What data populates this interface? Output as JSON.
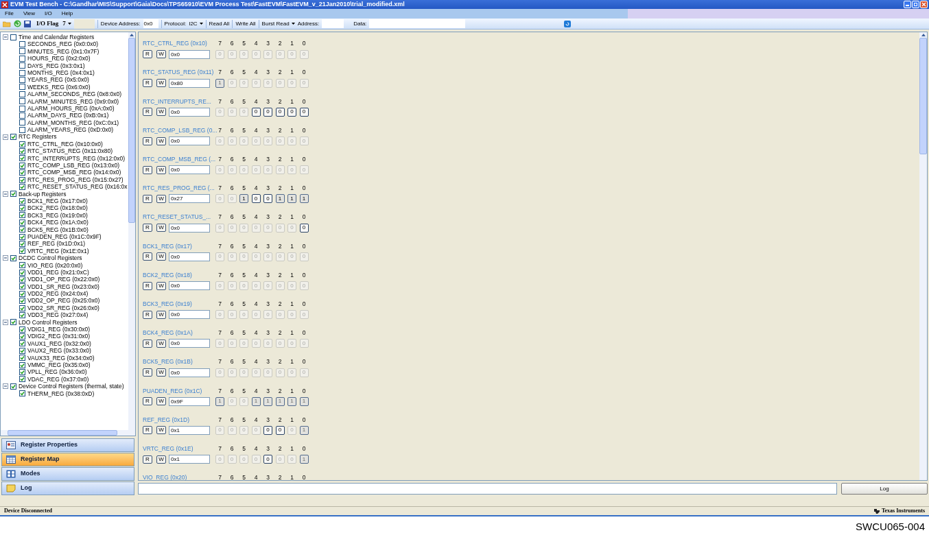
{
  "window": {
    "title": "EVM Test Bench - C:\\Gandhar\\MIS\\Support\\Gaia\\Docs\\TPS65910\\EVM Process Test\\FastEVM\\FastEVM_v_21Jan2010\\trial_modified.xml"
  },
  "menu": [
    "File",
    "View",
    "I/O",
    "Help"
  ],
  "toolbar": {
    "io_flag": {
      "label": "I/O Flag",
      "value": "7"
    },
    "device_address": {
      "label": "Device Address:",
      "value": "0x0"
    },
    "protocol": {
      "label": "Protocol:",
      "value": "I2C"
    },
    "read_all": "Read All",
    "write_all": "Write All",
    "burst_read": "Burst Read",
    "address": {
      "label": "Address:"
    },
    "data": {
      "label": "Data:"
    }
  },
  "tree": [
    {
      "label": "Time and Calendar Registers",
      "checked": false,
      "expanded": true,
      "children": [
        {
          "label": "SECONDS_REG (0x0:0x0)",
          "checked": false
        },
        {
          "label": "MINUTES_REG (0x1:0x7F)",
          "checked": false
        },
        {
          "label": "HOURS_REG (0x2:0x0)",
          "checked": false
        },
        {
          "label": "DAYS_REG (0x3:0x1)",
          "checked": false
        },
        {
          "label": "MONTHS_REG (0x4:0x1)",
          "checked": false
        },
        {
          "label": "YEARS_REG (0x5:0x0)",
          "checked": false
        },
        {
          "label": "WEEKS_REG (0x6:0x0)",
          "checked": false
        },
        {
          "label": "ALARM_SECONDS_REG (0x8:0x0)",
          "checked": false
        },
        {
          "label": "ALARM_MINUTES_REG (0x9:0x0)",
          "checked": false
        },
        {
          "label": "ALARM_HOURS_REG (0xA:0x0)",
          "checked": false
        },
        {
          "label": "ALARM_DAYS_REG (0xB:0x1)",
          "checked": false
        },
        {
          "label": "ALARM_MONTHS_REG (0xC:0x1)",
          "checked": false
        },
        {
          "label": "ALARM_YEARS_REG (0xD:0x0)",
          "checked": false
        }
      ]
    },
    {
      "label": "RTC Registers",
      "checked": true,
      "expanded": true,
      "children": [
        {
          "label": "RTC_CTRL_REG (0x10:0x0)",
          "checked": true
        },
        {
          "label": "RTC_STATUS_REG (0x11:0x80)",
          "checked": true
        },
        {
          "label": "RTC_INTERRUPTS_REG (0x12:0x0)",
          "checked": true
        },
        {
          "label": "RTC_COMP_LSB_REG (0x13:0x0)",
          "checked": true
        },
        {
          "label": "RTC_COMP_MSB_REG (0x14:0x0)",
          "checked": true
        },
        {
          "label": "RTC_RES_PROG_REG (0x15:0x27)",
          "checked": true
        },
        {
          "label": "RTC_RESET_STATUS_REG (0x16:0x",
          "checked": true
        }
      ]
    },
    {
      "label": "Back-up Registers",
      "checked": true,
      "expanded": true,
      "children": [
        {
          "label": "BCK1_REG (0x17:0x0)",
          "checked": true
        },
        {
          "label": "BCK2_REG (0x18:0x0)",
          "checked": true
        },
        {
          "label": "BCK3_REG (0x19:0x0)",
          "checked": true
        },
        {
          "label": "BCK4_REG (0x1A:0x0)",
          "checked": true
        },
        {
          "label": "BCK5_REG (0x1B:0x0)",
          "checked": true
        },
        {
          "label": "PUADEN_REG (0x1C:0x9F)",
          "checked": true
        },
        {
          "label": "REF_REG (0x1D:0x1)",
          "checked": true
        },
        {
          "label": "VRTC_REG (0x1E:0x1)",
          "checked": true
        }
      ]
    },
    {
      "label": "DCDC Control Registers",
      "checked": true,
      "expanded": true,
      "children": [
        {
          "label": "VIO_REG (0x20:0x0)",
          "checked": true
        },
        {
          "label": "VDD1_REG (0x21:0xC)",
          "checked": true
        },
        {
          "label": "VDD1_OP_REG (0x22:0x0)",
          "checked": true
        },
        {
          "label": "VDD1_SR_REG (0x23:0x0)",
          "checked": true
        },
        {
          "label": "VDD2_REG (0x24:0x4)",
          "checked": true
        },
        {
          "label": "VDD2_OP_REG (0x25:0x0)",
          "checked": true
        },
        {
          "label": "VDD2_SR_REG (0x26:0x0)",
          "checked": true
        },
        {
          "label": "VDD3_REG (0x27:0x4)",
          "checked": true
        }
      ]
    },
    {
      "label": "LDO Control Registers",
      "checked": true,
      "expanded": true,
      "children": [
        {
          "label": "VDIG1_REG (0x30:0x0)",
          "checked": true
        },
        {
          "label": "VDIG2_REG (0x31:0x0)",
          "checked": true
        },
        {
          "label": "VAUX1_REG (0x32:0x0)",
          "checked": true
        },
        {
          "label": "VAUX2_REG (0x33:0x0)",
          "checked": true
        },
        {
          "label": "VAUX33_REG (0x34:0x0)",
          "checked": true
        },
        {
          "label": "VMMC_REG (0x35:0x0)",
          "checked": true
        },
        {
          "label": "VPLL_REG (0x36:0x0)",
          "checked": true
        },
        {
          "label": "VDAC_REG (0x37:0x0)",
          "checked": true
        }
      ]
    },
    {
      "label": "Device Control Registers (thermal, state)",
      "checked": true,
      "expanded": true,
      "children": [
        {
          "label": "THERM_REG (0x38:0xD)",
          "checked": true
        }
      ]
    }
  ],
  "nav": [
    {
      "label": "Register Properties",
      "selected": false,
      "kind": "properties"
    },
    {
      "label": "Register Map",
      "selected": true,
      "kind": "map"
    },
    {
      "label": "Modes",
      "selected": false,
      "kind": "modes"
    },
    {
      "label": "Log",
      "selected": false,
      "kind": "log"
    }
  ],
  "registers": [
    {
      "name": "RTC_CTRL_REG (0x10)",
      "read": "R",
      "write": "W",
      "value": "0x0",
      "bits": [
        {
          "index": "7",
          "value": "0",
          "enabled": false,
          "pressed": false
        },
        {
          "index": "6",
          "value": "0",
          "enabled": false,
          "pressed": false
        },
        {
          "index": "5",
          "value": "0",
          "enabled": false,
          "pressed": false
        },
        {
          "index": "4",
          "value": "0",
          "enabled": false,
          "pressed": false
        },
        {
          "index": "3",
          "value": "0",
          "enabled": false,
          "pressed": false
        },
        {
          "index": "2",
          "value": "0",
          "enabled": false,
          "pressed": false
        },
        {
          "index": "1",
          "value": "0",
          "enabled": false,
          "pressed": false
        },
        {
          "index": "0",
          "value": "0",
          "enabled": false,
          "pressed": false
        }
      ]
    },
    {
      "name": "RTC_STATUS_REG (0x11)",
      "read": "R",
      "write": "W",
      "value": "0x80",
      "bits": [
        {
          "index": "7",
          "value": "1",
          "enabled": false,
          "pressed": true
        },
        {
          "index": "6",
          "value": "0",
          "enabled": false,
          "pressed": false
        },
        {
          "index": "5",
          "value": "0",
          "enabled": false,
          "pressed": false
        },
        {
          "index": "4",
          "value": "0",
          "enabled": false,
          "pressed": false
        },
        {
          "index": "3",
          "value": "0",
          "enabled": false,
          "pressed": false
        },
        {
          "index": "2",
          "value": "0",
          "enabled": false,
          "pressed": false
        },
        {
          "index": "1",
          "value": "0",
          "enabled": false,
          "pressed": false
        },
        {
          "index": "0",
          "value": "0",
          "enabled": false,
          "pressed": false
        }
      ]
    },
    {
      "name": "RTC_INTERRUPTS_RE...",
      "read": "R",
      "write": "W",
      "value": "0x0",
      "bits": [
        {
          "index": "7",
          "value": "0",
          "enabled": false,
          "pressed": false
        },
        {
          "index": "6",
          "value": "0",
          "enabled": false,
          "pressed": false
        },
        {
          "index": "5",
          "value": "0",
          "enabled": false,
          "pressed": false
        },
        {
          "index": "4",
          "value": "0",
          "enabled": true,
          "pressed": false
        },
        {
          "index": "3",
          "value": "0",
          "enabled": true,
          "pressed": false
        },
        {
          "index": "2",
          "value": "0",
          "enabled": true,
          "pressed": false
        },
        {
          "index": "1",
          "value": "0",
          "enabled": true,
          "pressed": false
        },
        {
          "index": "0",
          "value": "0",
          "enabled": true,
          "pressed": false
        }
      ]
    },
    {
      "name": "RTC_COMP_LSB_REG (0...",
      "read": "R",
      "write": "W",
      "value": "0x0",
      "bits": [
        {
          "index": "7",
          "value": "0",
          "enabled": false,
          "pressed": false
        },
        {
          "index": "6",
          "value": "0",
          "enabled": false,
          "pressed": false
        },
        {
          "index": "5",
          "value": "0",
          "enabled": false,
          "pressed": false
        },
        {
          "index": "4",
          "value": "0",
          "enabled": false,
          "pressed": false
        },
        {
          "index": "3",
          "value": "0",
          "enabled": false,
          "pressed": false
        },
        {
          "index": "2",
          "value": "0",
          "enabled": false,
          "pressed": false
        },
        {
          "index": "1",
          "value": "0",
          "enabled": false,
          "pressed": false
        },
        {
          "index": "0",
          "value": "0",
          "enabled": false,
          "pressed": false
        }
      ]
    },
    {
      "name": "RTC_COMP_MSB_REG (...",
      "read": "R",
      "write": "W",
      "value": "0x0",
      "bits": [
        {
          "index": "7",
          "value": "0",
          "enabled": false,
          "pressed": false
        },
        {
          "index": "6",
          "value": "0",
          "enabled": false,
          "pressed": false
        },
        {
          "index": "5",
          "value": "0",
          "enabled": false,
          "pressed": false
        },
        {
          "index": "4",
          "value": "0",
          "enabled": false,
          "pressed": false
        },
        {
          "index": "3",
          "value": "0",
          "enabled": false,
          "pressed": false
        },
        {
          "index": "2",
          "value": "0",
          "enabled": false,
          "pressed": false
        },
        {
          "index": "1",
          "value": "0",
          "enabled": false,
          "pressed": false
        },
        {
          "index": "0",
          "value": "0",
          "enabled": false,
          "pressed": false
        }
      ]
    },
    {
      "name": "RTC_RES_PROG_REG (...",
      "read": "R",
      "write": "W",
      "value": "0x27",
      "bits": [
        {
          "index": "7",
          "value": "0",
          "enabled": false,
          "pressed": false
        },
        {
          "index": "6",
          "value": "0",
          "enabled": false,
          "pressed": false
        },
        {
          "index": "5",
          "value": "1",
          "enabled": true,
          "pressed": true
        },
        {
          "index": "4",
          "value": "0",
          "enabled": true,
          "pressed": false
        },
        {
          "index": "3",
          "value": "0",
          "enabled": true,
          "pressed": false
        },
        {
          "index": "2",
          "value": "1",
          "enabled": true,
          "pressed": true
        },
        {
          "index": "1",
          "value": "1",
          "enabled": true,
          "pressed": true
        },
        {
          "index": "0",
          "value": "1",
          "enabled": true,
          "pressed": true
        }
      ]
    },
    {
      "name": "RTC_RESET_STATUS_...",
      "read": "R",
      "write": "W",
      "value": "0x0",
      "bits": [
        {
          "index": "7",
          "value": "0",
          "enabled": false,
          "pressed": false
        },
        {
          "index": "6",
          "value": "0",
          "enabled": false,
          "pressed": false
        },
        {
          "index": "5",
          "value": "0",
          "enabled": false,
          "pressed": false
        },
        {
          "index": "4",
          "value": "0",
          "enabled": false,
          "pressed": false
        },
        {
          "index": "3",
          "value": "0",
          "enabled": false,
          "pressed": false
        },
        {
          "index": "2",
          "value": "0",
          "enabled": false,
          "pressed": false
        },
        {
          "index": "1",
          "value": "0",
          "enabled": false,
          "pressed": false
        },
        {
          "index": "0",
          "value": "0",
          "enabled": true,
          "pressed": false
        }
      ]
    },
    {
      "name": "BCK1_REG (0x17)",
      "read": "R",
      "write": "W",
      "value": "0x0",
      "bits": [
        {
          "index": "7",
          "value": "0",
          "enabled": false,
          "pressed": false
        },
        {
          "index": "6",
          "value": "0",
          "enabled": false,
          "pressed": false
        },
        {
          "index": "5",
          "value": "0",
          "enabled": false,
          "pressed": false
        },
        {
          "index": "4",
          "value": "0",
          "enabled": false,
          "pressed": false
        },
        {
          "index": "3",
          "value": "0",
          "enabled": false,
          "pressed": false
        },
        {
          "index": "2",
          "value": "0",
          "enabled": false,
          "pressed": false
        },
        {
          "index": "1",
          "value": "0",
          "enabled": false,
          "pressed": false
        },
        {
          "index": "0",
          "value": "0",
          "enabled": false,
          "pressed": false
        }
      ]
    },
    {
      "name": "BCK2_REG (0x18)",
      "read": "R",
      "write": "W",
      "value": "0x0",
      "bits": [
        {
          "index": "7",
          "value": "0",
          "enabled": false,
          "pressed": false
        },
        {
          "index": "6",
          "value": "0",
          "enabled": false,
          "pressed": false
        },
        {
          "index": "5",
          "value": "0",
          "enabled": false,
          "pressed": false
        },
        {
          "index": "4",
          "value": "0",
          "enabled": false,
          "pressed": false
        },
        {
          "index": "3",
          "value": "0",
          "enabled": false,
          "pressed": false
        },
        {
          "index": "2",
          "value": "0",
          "enabled": false,
          "pressed": false
        },
        {
          "index": "1",
          "value": "0",
          "enabled": false,
          "pressed": false
        },
        {
          "index": "0",
          "value": "0",
          "enabled": false,
          "pressed": false
        }
      ]
    },
    {
      "name": "BCK3_REG (0x19)",
      "read": "R",
      "write": "W",
      "value": "0x0",
      "bits": [
        {
          "index": "7",
          "value": "0",
          "enabled": false,
          "pressed": false
        },
        {
          "index": "6",
          "value": "0",
          "enabled": false,
          "pressed": false
        },
        {
          "index": "5",
          "value": "0",
          "enabled": false,
          "pressed": false
        },
        {
          "index": "4",
          "value": "0",
          "enabled": false,
          "pressed": false
        },
        {
          "index": "3",
          "value": "0",
          "enabled": false,
          "pressed": false
        },
        {
          "index": "2",
          "value": "0",
          "enabled": false,
          "pressed": false
        },
        {
          "index": "1",
          "value": "0",
          "enabled": false,
          "pressed": false
        },
        {
          "index": "0",
          "value": "0",
          "enabled": false,
          "pressed": false
        }
      ]
    },
    {
      "name": "BCK4_REG (0x1A)",
      "read": "R",
      "write": "W",
      "value": "0x0",
      "bits": [
        {
          "index": "7",
          "value": "0",
          "enabled": false,
          "pressed": false
        },
        {
          "index": "6",
          "value": "0",
          "enabled": false,
          "pressed": false
        },
        {
          "index": "5",
          "value": "0",
          "enabled": false,
          "pressed": false
        },
        {
          "index": "4",
          "value": "0",
          "enabled": false,
          "pressed": false
        },
        {
          "index": "3",
          "value": "0",
          "enabled": false,
          "pressed": false
        },
        {
          "index": "2",
          "value": "0",
          "enabled": false,
          "pressed": false
        },
        {
          "index": "1",
          "value": "0",
          "enabled": false,
          "pressed": false
        },
        {
          "index": "0",
          "value": "0",
          "enabled": false,
          "pressed": false
        }
      ]
    },
    {
      "name": "BCK5_REG (0x1B)",
      "read": "R",
      "write": "W",
      "value": "0x0",
      "bits": [
        {
          "index": "7",
          "value": "0",
          "enabled": false,
          "pressed": false
        },
        {
          "index": "6",
          "value": "0",
          "enabled": false,
          "pressed": false
        },
        {
          "index": "5",
          "value": "0",
          "enabled": false,
          "pressed": false
        },
        {
          "index": "4",
          "value": "0",
          "enabled": false,
          "pressed": false
        },
        {
          "index": "3",
          "value": "0",
          "enabled": false,
          "pressed": false
        },
        {
          "index": "2",
          "value": "0",
          "enabled": false,
          "pressed": false
        },
        {
          "index": "1",
          "value": "0",
          "enabled": false,
          "pressed": false
        },
        {
          "index": "0",
          "value": "0",
          "enabled": false,
          "pressed": false
        }
      ]
    },
    {
      "name": "PUADEN_REG (0x1C)",
      "read": "R",
      "write": "W",
      "value": "0x9F",
      "bits": [
        {
          "index": "7",
          "value": "1",
          "enabled": false,
          "pressed": true
        },
        {
          "index": "6",
          "value": "0",
          "enabled": false,
          "pressed": false
        },
        {
          "index": "5",
          "value": "0",
          "enabled": false,
          "pressed": false
        },
        {
          "index": "4",
          "value": "1",
          "enabled": false,
          "pressed": true
        },
        {
          "index": "3",
          "value": "1",
          "enabled": false,
          "pressed": true
        },
        {
          "index": "2",
          "value": "1",
          "enabled": false,
          "pressed": true
        },
        {
          "index": "1",
          "value": "1",
          "enabled": false,
          "pressed": true
        },
        {
          "index": "0",
          "value": "1",
          "enabled": false,
          "pressed": true
        }
      ]
    },
    {
      "name": "REF_REG (0x1D)",
      "read": "R",
      "write": "W",
      "value": "0x1",
      "bits": [
        {
          "index": "7",
          "value": "0",
          "enabled": false,
          "pressed": false
        },
        {
          "index": "6",
          "value": "0",
          "enabled": false,
          "pressed": false
        },
        {
          "index": "5",
          "value": "0",
          "enabled": false,
          "pressed": false
        },
        {
          "index": "4",
          "value": "0",
          "enabled": false,
          "pressed": false
        },
        {
          "index": "3",
          "value": "0",
          "enabled": true,
          "pressed": false
        },
        {
          "index": "2",
          "value": "0",
          "enabled": true,
          "pressed": false
        },
        {
          "index": "1",
          "value": "0",
          "enabled": false,
          "pressed": false
        },
        {
          "index": "0",
          "value": "1",
          "enabled": false,
          "pressed": true
        }
      ]
    },
    {
      "name": "VRTC_REG (0x1E)",
      "read": "R",
      "write": "W",
      "value": "0x1",
      "bits": [
        {
          "index": "7",
          "value": "0",
          "enabled": false,
          "pressed": false
        },
        {
          "index": "6",
          "value": "0",
          "enabled": false,
          "pressed": false
        },
        {
          "index": "5",
          "value": "0",
          "enabled": false,
          "pressed": false
        },
        {
          "index": "4",
          "value": "0",
          "enabled": false,
          "pressed": false
        },
        {
          "index": "3",
          "value": "0",
          "enabled": true,
          "pressed": false
        },
        {
          "index": "2",
          "value": "0",
          "enabled": false,
          "pressed": false
        },
        {
          "index": "1",
          "value": "0",
          "enabled": false,
          "pressed": false
        },
        {
          "index": "0",
          "value": "1",
          "enabled": false,
          "pressed": true
        }
      ]
    },
    {
      "name": "VIO_REG (0x20)",
      "bits": [
        {
          "index": "7"
        },
        {
          "index": "6"
        },
        {
          "index": "5"
        },
        {
          "index": "4"
        },
        {
          "index": "3"
        },
        {
          "index": "2"
        },
        {
          "index": "1"
        },
        {
          "index": "0"
        }
      ]
    }
  ],
  "log_button": "Log",
  "status_bar": {
    "status": "Device Disconnected",
    "brand": "Texas Instruments"
  },
  "caption": "SWCU065-004"
}
